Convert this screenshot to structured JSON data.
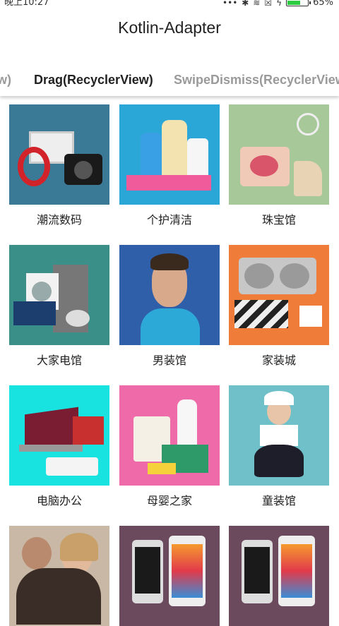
{
  "status_bar": {
    "time": "晚上10:27",
    "battery": "65%",
    "battery_level": 0.65,
    "icons": [
      "dots-icon",
      "bluetooth-icon",
      "wifi-icon",
      "sim-icon",
      "charging-icon",
      "battery-icon"
    ]
  },
  "app": {
    "title": "Kotlin-Adapter"
  },
  "tabs": [
    {
      "label": "w)",
      "state": "partial"
    },
    {
      "label": "Drag(RecyclerView)",
      "state": "selected"
    },
    {
      "label": "SwipeDismiss(RecyclerView",
      "state": "partial"
    }
  ],
  "grid": {
    "items": [
      {
        "label": "潮流数码",
        "bg": "#3b7a96",
        "icon": "headphones-camera-tablet-image"
      },
      {
        "label": "个护清洁",
        "bg": "#2aa7d6",
        "icon": "shampoo-bottles-image"
      },
      {
        "label": "珠宝馆",
        "bg": "#a7c99a",
        "icon": "handbag-heels-image"
      },
      {
        "label": "大家电馆",
        "bg": "#3a8f88",
        "icon": "washer-fridge-image"
      },
      {
        "label": "男装馆",
        "bg": "#2e5fa8",
        "icon": "man-sweater-image"
      },
      {
        "label": "家装城",
        "bg": "#f07c3a",
        "icon": "kitchen-sink-image"
      },
      {
        "label": "电脑办公",
        "bg": "#18e3e0",
        "icon": "laptop-projector-image"
      },
      {
        "label": "母婴之家",
        "bg": "#ee6aa8",
        "icon": "baby-formula-image"
      },
      {
        "label": "童装馆",
        "bg": "#6fc0c9",
        "icon": "girl-dress-image"
      },
      {
        "label": "",
        "bg": "#c9b8a6",
        "icon": "couple-image"
      },
      {
        "label": "",
        "bg": "#6b4a5e",
        "icon": "smartphones-image"
      },
      {
        "label": "",
        "bg": "#6b4a5e",
        "icon": "smartphones-image"
      }
    ]
  }
}
